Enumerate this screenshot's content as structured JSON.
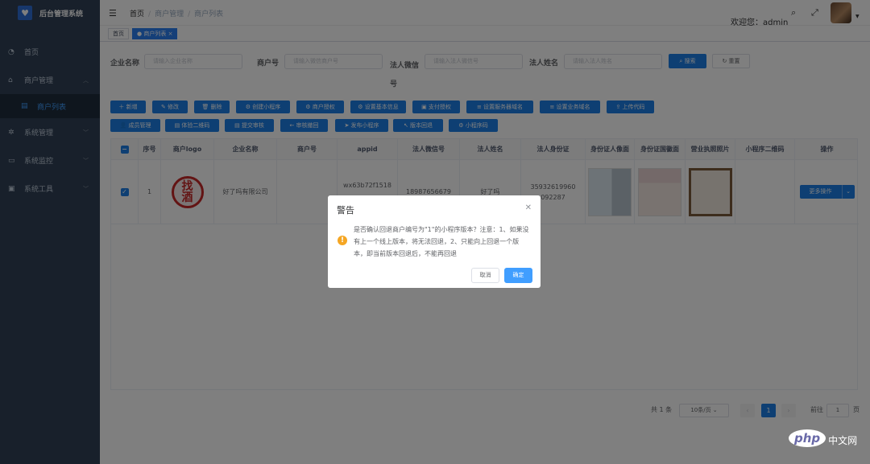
{
  "app": {
    "title": "后台管理系统"
  },
  "sidebar": {
    "items": [
      {
        "label": "首页",
        "icon": "dashboard-icon"
      },
      {
        "label": "商户管理",
        "icon": "shop-icon"
      },
      {
        "label": "商户列表",
        "icon": "list-icon"
      },
      {
        "label": "系统管理",
        "icon": "gear-icon"
      },
      {
        "label": "系统监控",
        "icon": "monitor-icon"
      },
      {
        "label": "系统工具",
        "icon": "tool-icon"
      }
    ]
  },
  "header": {
    "breadcrumb": [
      "首页",
      "商户管理",
      "商户列表"
    ],
    "welcome": "欢迎您：admin"
  },
  "tags": {
    "home": "首页",
    "current": "商户列表"
  },
  "search": {
    "company_label": "企业名称",
    "company_ph": "请输入企业名称",
    "merchant_label": "商户号",
    "merchant_ph": "请输入微信商户号",
    "wechat_label": "法人微信号",
    "wechat_ph": "请输入法人微信号",
    "name_label": "法人姓名",
    "name_ph": "请输入法人姓名",
    "search_btn": "搜索",
    "reset_btn": "重置"
  },
  "toolbar": {
    "row1": [
      "新增",
      "修改",
      "删除",
      "创建小程序",
      "商户授权",
      "设置基本信息",
      "支付授权",
      "设置服务器域名",
      "设置业务域名",
      "上传代码"
    ],
    "row2": [
      "成员管理",
      "体验二维码",
      "提交审核",
      "审核撤回",
      "发布小程序",
      "版本回退",
      "小程序码"
    ]
  },
  "table": {
    "headers": [
      "序号",
      "商户logo",
      "企业名称",
      "商户号",
      "appid",
      "法人微信号",
      "法人姓名",
      "法人身份证",
      "身份证人像面",
      "身份证国徽面",
      "营业执照照片",
      "小程序二维码",
      "操作"
    ],
    "row": {
      "index": "1",
      "logo_text": [
        "找",
        "酒"
      ],
      "company": "好了吗有限公司",
      "merchant_no": "",
      "appid": "wx63b72f1518",
      "wechat": "18987656679",
      "name": "好了吗",
      "id_card": [
        "35932619960",
        "092287"
      ],
      "action": "更多操作"
    }
  },
  "pagination": {
    "total": "共 1 条",
    "size": "10条/页",
    "page": "1",
    "goto_prefix": "前往",
    "goto_value": "1",
    "goto_suffix": "页"
  },
  "dialog": {
    "title": "警告",
    "message": "是否确认回退商户编号为\"1\"的小程序版本？注意：1、如果没有上一个线上版本，将无法回退，2、只能向上回退一个版本，即当前版本回退后，不能再回退",
    "cancel": "取消",
    "confirm": "确定"
  },
  "watermark": {
    "brand": "php",
    "text": "中文网"
  },
  "colors": {
    "primary": "#1d7fe6",
    "sidebar": "#304156",
    "warning": "#f5a623"
  }
}
